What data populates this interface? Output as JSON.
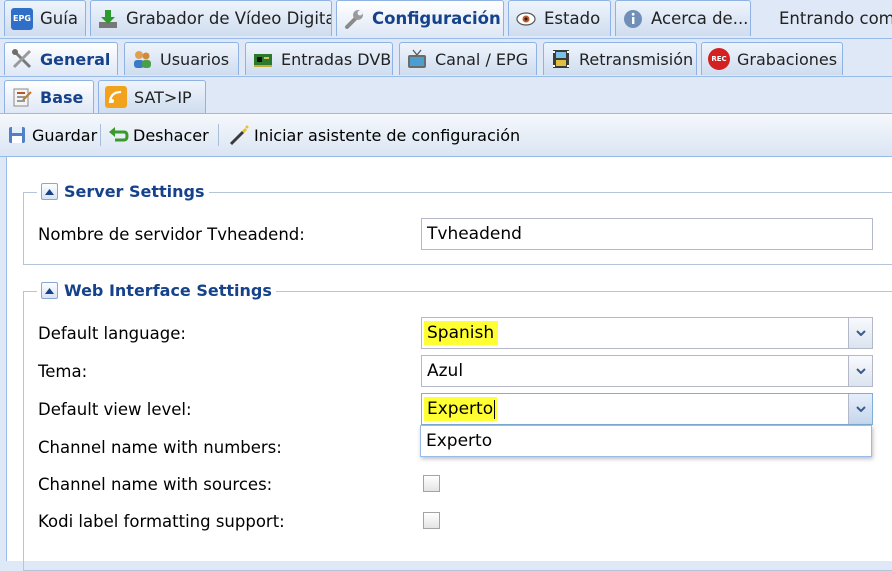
{
  "top_tabs": [
    {
      "label": "Guía",
      "icon": "epg-icon"
    },
    {
      "label": "Grabador de Vídeo Digital",
      "icon": "download-icon"
    },
    {
      "label": "Configuración",
      "icon": "wrench-icon",
      "active": true
    },
    {
      "label": "Estado",
      "icon": "eye-icon"
    },
    {
      "label": "Acerca de...",
      "icon": "info-icon"
    }
  ],
  "login_status": "Entrando como",
  "config_tabs": [
    {
      "label": "General",
      "icon": "tools-icon",
      "active": true
    },
    {
      "label": "Usuarios",
      "icon": "users-icon"
    },
    {
      "label": "Entradas DVB",
      "icon": "dvb-card-icon"
    },
    {
      "label": "Canal / EPG",
      "icon": "tv-icon"
    },
    {
      "label": "Retransmisión",
      "icon": "film-icon"
    },
    {
      "label": "Grabaciones",
      "icon": "rec-icon"
    }
  ],
  "sub_tabs": [
    {
      "label": "Base",
      "icon": "base-icon",
      "active": true
    },
    {
      "label": "SAT>IP",
      "icon": "satip-icon"
    }
  ],
  "toolbar": {
    "save_label": "Guardar",
    "undo_label": "Deshacer",
    "wizard_label": "Iniciar asistente de configuración"
  },
  "server_settings": {
    "title": "Server Settings",
    "server_name_label": "Nombre de servidor Tvheadend:",
    "server_name_value": "Tvheadend"
  },
  "web_settings": {
    "title": "Web Interface Settings",
    "language_label": "Default language:",
    "language_value": "Spanish",
    "theme_label": "Tema:",
    "theme_value": "Azul",
    "view_level_label": "Default view level:",
    "view_level_value": "Experto",
    "view_level_options": [
      "Experto"
    ],
    "channel_numbers_label": "Channel name with numbers:",
    "channel_sources_label": "Channel name with sources:",
    "kodi_label": "Kodi label formatting support:"
  },
  "colors": {
    "highlight": "#ffff33",
    "legend_text": "#15428b",
    "tab_border": "#8db2e3",
    "rec_badge": "#d42020"
  }
}
